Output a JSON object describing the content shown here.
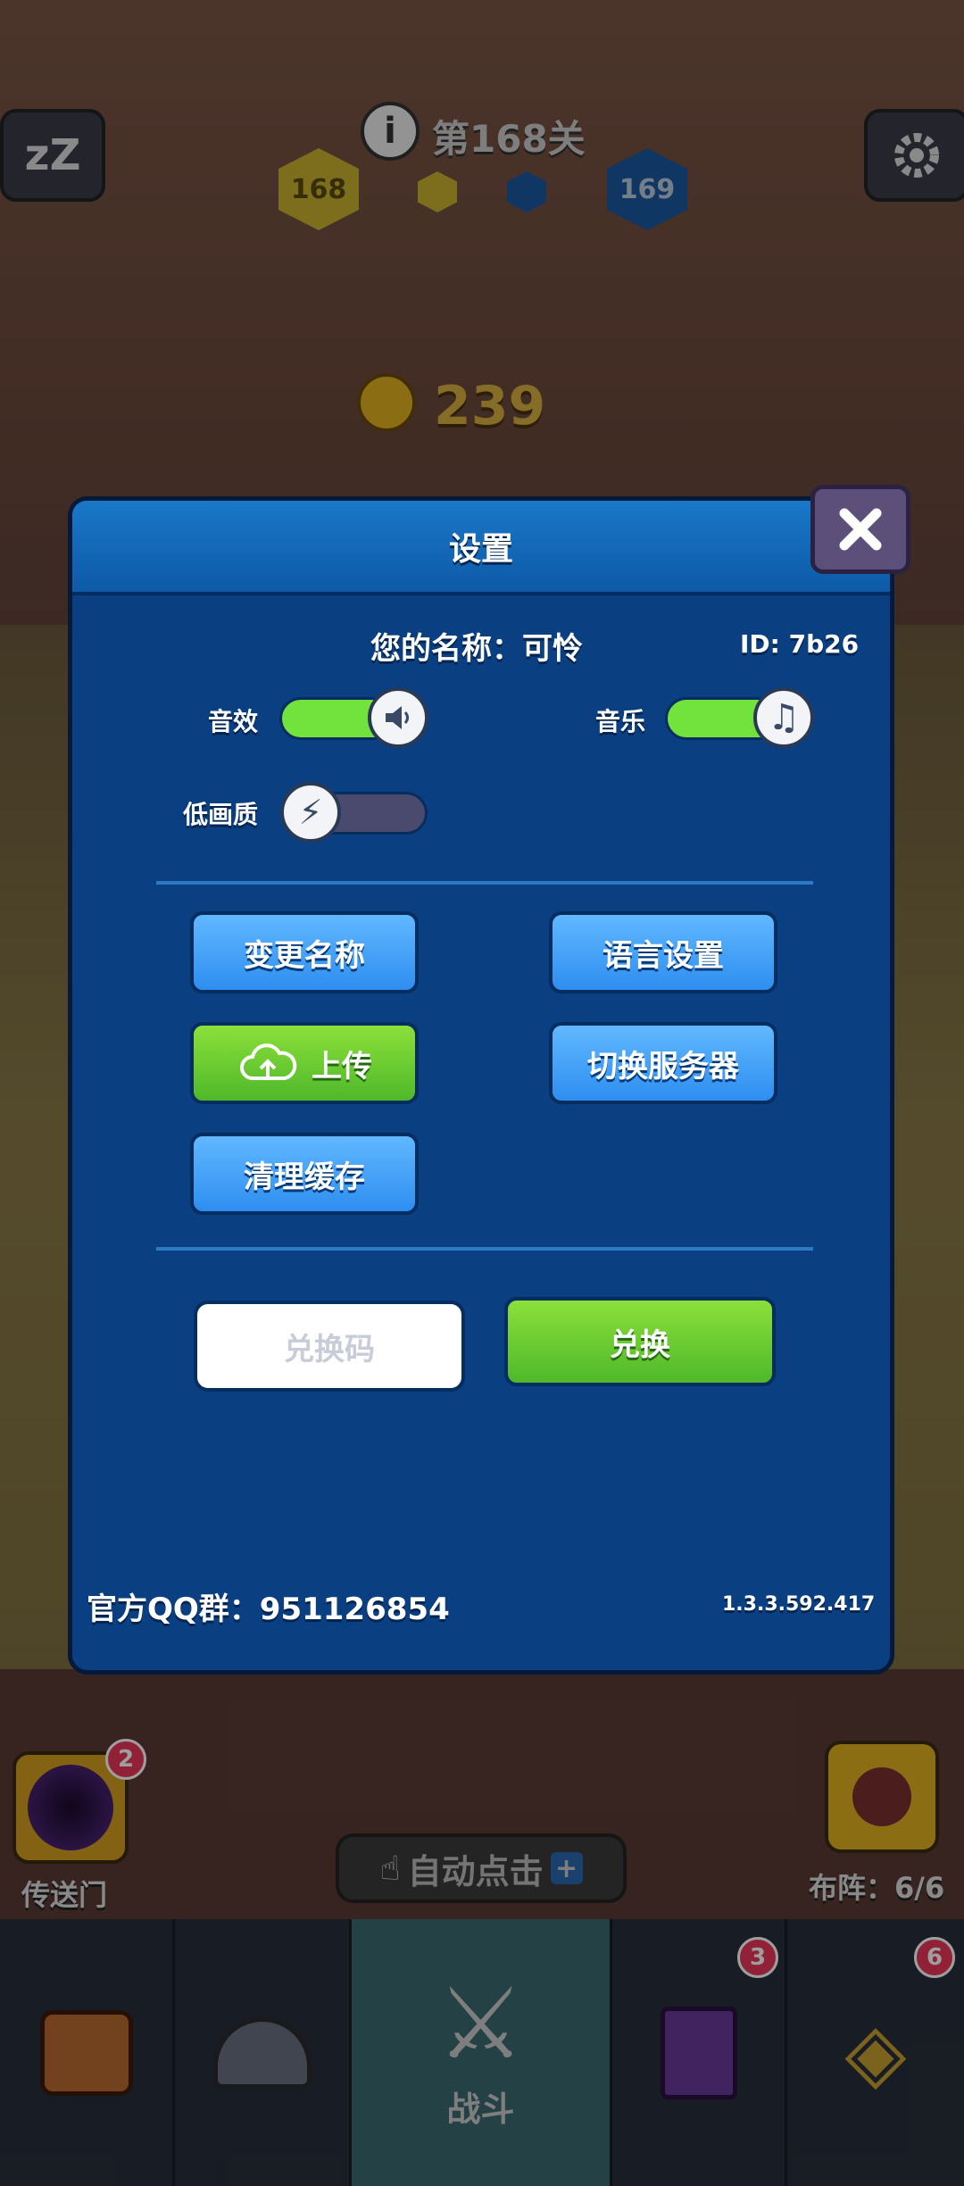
{
  "hud": {
    "level_text": "第168关",
    "current_level": "168",
    "next_level": "169",
    "coins": "239"
  },
  "settings": {
    "title": "设置",
    "name_label": "您的名称：可怜",
    "id_label": "ID: 7b26",
    "sound_label": "音效",
    "music_label": "音乐",
    "low_quality_label": "低画质",
    "sound_on": true,
    "music_on": true,
    "low_quality_on": false,
    "change_name": "变更名称",
    "language": "语言设置",
    "upload": "上传",
    "switch_server": "切换服务器",
    "clear_cache": "清理缓存",
    "redeem_placeholder": "兑换码",
    "redeem_button": "兑换",
    "qq_group": "官方QQ群：951126854",
    "version": "1.3.3.592.417"
  },
  "side": {
    "portal_label": "传送门",
    "portal_badge": "2",
    "formation_label": "布阵：6/6",
    "auto_click_label": "自动点击"
  },
  "tabs": {
    "battle_label": "战斗",
    "book_badge": "3",
    "amulet_badge": "6"
  },
  "colors": {
    "panel_bg": "#0a3f82",
    "button_blue": "#3a9af5",
    "button_green": "#5cc32a",
    "toggle_on": "#72e33c",
    "toggle_off": "#4a4a6e"
  }
}
